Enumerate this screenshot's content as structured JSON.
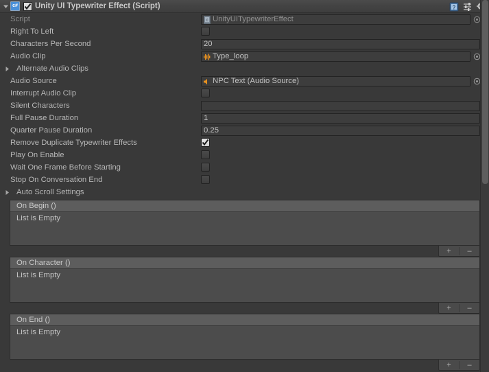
{
  "window": {
    "title": "Unity UI Typewriter Effect (Script)",
    "enabled": true,
    "script_icon": "csharp-script-icon",
    "foldout_expanded": true
  },
  "header_icons": [
    {
      "name": "help-icon",
      "label": "?"
    },
    {
      "name": "preset-icon",
      "label": "Preset"
    },
    {
      "name": "gear-icon",
      "label": "Settings"
    }
  ],
  "properties": [
    {
      "label": "Script",
      "type": "object",
      "value": "UnityUITypewriterEffect",
      "icon": "script-asset-icon",
      "readonly": true,
      "picker": true
    },
    {
      "label": "Right To Left",
      "type": "checkbox",
      "value": false
    },
    {
      "label": "Characters Per Second",
      "type": "text",
      "value": "20"
    },
    {
      "label": "Audio Clip",
      "type": "object",
      "value": "Type_loop",
      "icon": "audio-clip-icon",
      "readonly": false,
      "picker": true
    },
    {
      "label": "Alternate Audio Clips",
      "type": "foldout",
      "value": ""
    },
    {
      "label": "Audio Source",
      "type": "object",
      "value": "NPC Text (Audio Source)",
      "icon": "audio-source-icon",
      "readonly": false,
      "picker": true
    },
    {
      "label": "Interrupt Audio Clip",
      "type": "checkbox",
      "value": false
    },
    {
      "label": "Silent Characters",
      "type": "text",
      "value": ""
    },
    {
      "label": "Full Pause Duration",
      "type": "text",
      "value": "1"
    },
    {
      "label": "Quarter Pause Duration",
      "type": "text",
      "value": "0.25"
    },
    {
      "label": "Remove Duplicate Typewriter Effects",
      "type": "checkbox",
      "value": true
    },
    {
      "label": "Play On Enable",
      "type": "checkbox",
      "value": false
    },
    {
      "label": "Wait One Frame Before Starting",
      "type": "checkbox",
      "value": false
    },
    {
      "label": "Stop On Conversation End",
      "type": "checkbox",
      "value": false
    },
    {
      "label": "Auto Scroll Settings",
      "type": "foldout",
      "value": ""
    }
  ],
  "events": [
    {
      "title": "On Begin ()",
      "empty_text": "List is Empty",
      "add_label": "+",
      "remove_label": "–"
    },
    {
      "title": "On Character ()",
      "empty_text": "List is Empty",
      "add_label": "+",
      "remove_label": "–"
    },
    {
      "title": "On End ()",
      "empty_text": "List is Empty",
      "add_label": "+",
      "remove_label": "–"
    }
  ],
  "colors": {
    "background": "#393939",
    "header": "#434343",
    "field": "#3d3d3d",
    "event_box": "#4c4c4c",
    "event_header": "#5d5d5d",
    "accent_orange": "#e08c1e",
    "accent_blue": "#4a90d9",
    "text": "#b7b7b7"
  },
  "scrollbar": {
    "thumb_top": 0,
    "thumb_height": 268
  }
}
